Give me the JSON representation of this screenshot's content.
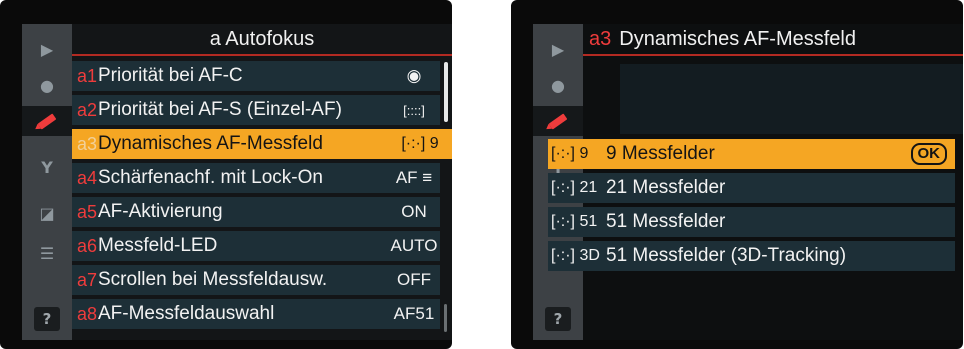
{
  "left": {
    "title": "a Autofokus",
    "tabs": [
      {
        "icon": "playback-icon",
        "glyph": "▶"
      },
      {
        "icon": "camera-icon",
        "glyph": "●"
      },
      {
        "icon": "pencil-icon",
        "glyph": ""
      },
      {
        "icon": "wrench-icon",
        "glyph": "Y"
      },
      {
        "icon": "retouch-icon",
        "glyph": "◪"
      },
      {
        "icon": "my-menu-icon",
        "glyph": "☰"
      }
    ],
    "help": "?",
    "items": [
      {
        "code": "a1",
        "label": "Priorität bei AF-C",
        "value": "◉"
      },
      {
        "code": "a2",
        "label": "Priorität bei AF-S (Einzel-AF)",
        "value": "[::::]"
      },
      {
        "code": "a3",
        "label": "Dynamisches AF-Messfeld",
        "value": "[·:·] 9"
      },
      {
        "code": "a4",
        "label": "Schärfenachf. mit Lock-On",
        "value": "AF ≡"
      },
      {
        "code": "a5",
        "label": "AF-Aktivierung",
        "value": "ON"
      },
      {
        "code": "a6",
        "label": "Messfeld-LED",
        "value": "AUTO"
      },
      {
        "code": "a7",
        "label": "Scrollen bei Messfeldausw.",
        "value": "OFF"
      },
      {
        "code": "a8",
        "label": "AF-Messfeldauswahl",
        "value": "AF51"
      }
    ]
  },
  "right": {
    "title_code": "a3",
    "title": "Dynamisches AF-Messfeld",
    "help": "?",
    "ok": "OK",
    "options": [
      {
        "icon": "[·:·] 9",
        "label": "9 Messfelder"
      },
      {
        "icon": "[·:·] 21",
        "label": "21 Messfelder"
      },
      {
        "icon": "[·:·] 51",
        "label": "51 Messfelder"
      },
      {
        "icon": "[·:·] 3D",
        "label": "51 Messfelder (3D-Tracking)"
      }
    ]
  }
}
